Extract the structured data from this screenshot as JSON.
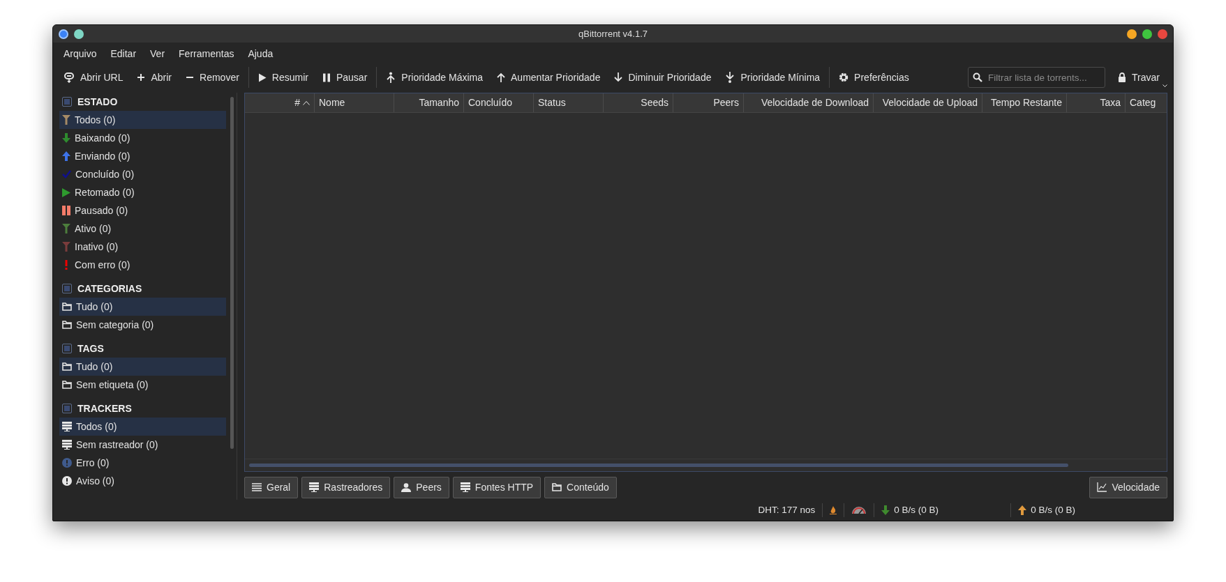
{
  "window": {
    "title": "qBittorrent v4.1.7"
  },
  "menu": [
    "Arquivo",
    "Editar",
    "Ver",
    "Ferramentas",
    "Ajuda"
  ],
  "toolbar": {
    "groups": [
      [
        "Abrir URL",
        "Abrir",
        "Remover"
      ],
      [
        "Resumir",
        "Pausar"
      ],
      [
        "Prioridade Máxima",
        "Aumentar Prioridade",
        "Diminuir Prioridade",
        "Prioridade Mínima"
      ],
      [
        "Preferências"
      ]
    ],
    "search": {
      "placeholder": "Filtrar lista de torrents..."
    },
    "lock_button": "Travar"
  },
  "sidebar": {
    "sections": [
      {
        "title": "ESTADO",
        "items": [
          {
            "label": "Todos (0)",
            "selected": true
          },
          {
            "label": "Baixando (0)",
            "selected": false
          },
          {
            "label": "Enviando (0)",
            "selected": false
          },
          {
            "label": "Concluído (0)",
            "selected": false
          },
          {
            "label": "Retomado (0)",
            "selected": false
          },
          {
            "label": "Pausado (0)",
            "selected": false
          },
          {
            "label": "Ativo (0)",
            "selected": false
          },
          {
            "label": "Inativo (0)",
            "selected": false
          },
          {
            "label": "Com erro (0)",
            "selected": false
          }
        ]
      },
      {
        "title": "CATEGORIAS",
        "items": [
          {
            "label": "Tudo (0)",
            "selected": true
          },
          {
            "label": "Sem categoria (0)",
            "selected": false
          }
        ]
      },
      {
        "title": "TAGS",
        "items": [
          {
            "label": "Tudo (0)",
            "selected": true
          },
          {
            "label": "Sem etiqueta (0)",
            "selected": false
          }
        ]
      },
      {
        "title": "TRACKERS",
        "items": [
          {
            "label": "Todos (0)",
            "selected": true
          },
          {
            "label": "Sem rastreador (0)",
            "selected": false
          },
          {
            "label": "Erro (0)",
            "selected": false
          },
          {
            "label": "Aviso (0)",
            "selected": false
          }
        ]
      }
    ]
  },
  "table": {
    "columns": [
      {
        "label": "#",
        "sorted": true
      },
      {
        "label": "Nome",
        "sorted": false
      },
      {
        "label": "Tamanho",
        "sorted": false
      },
      {
        "label": "Concluído",
        "sorted": false
      },
      {
        "label": "Status",
        "sorted": false
      },
      {
        "label": "Seeds",
        "sorted": false
      },
      {
        "label": "Peers",
        "sorted": false
      },
      {
        "label": "Velocidade de Download",
        "sorted": false
      },
      {
        "label": "Velocidade de Upload",
        "sorted": false
      },
      {
        "label": "Tempo Restante",
        "sorted": false
      },
      {
        "label": "Taxa",
        "sorted": false
      },
      {
        "label": "Categ",
        "sorted": false
      }
    ]
  },
  "bottom_tabs": [
    "Geral",
    "Rastreadores",
    "Peers",
    "Fontes HTTP",
    "Conteúdo"
  ],
  "speed_button": "Velocidade",
  "status_bar": {
    "dht": "DHT: 177 nos",
    "download": "0 B/s (0 B)",
    "upload": "0 B/s (0 B)"
  }
}
